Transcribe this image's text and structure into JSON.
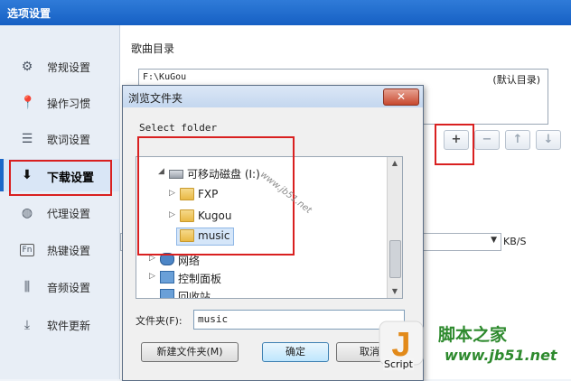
{
  "window": {
    "title": "选项设置"
  },
  "sidebar": {
    "items": [
      {
        "label": "常规设置",
        "icon": "gear-icon"
      },
      {
        "label": "操作习惯",
        "icon": "pin-icon"
      },
      {
        "label": "歌词设置",
        "icon": "lyrics-icon"
      },
      {
        "label": "下载设置",
        "icon": "download-icon",
        "active": true
      },
      {
        "label": "代理设置",
        "icon": "globe-icon"
      },
      {
        "label": "热键设置",
        "icon": "hotkey-icon"
      },
      {
        "label": "音频设置",
        "icon": "equalizer-icon"
      },
      {
        "label": "软件更新",
        "icon": "update-icon"
      }
    ]
  },
  "main": {
    "section_title": "歌曲目录",
    "directory": {
      "path": "F:\\KuGou",
      "note": "(默认目录)"
    },
    "speed_unit": "KB/S",
    "toolbar": {
      "add": "+",
      "remove": "−",
      "up": "↑",
      "down": "↓"
    }
  },
  "dialog": {
    "title": "浏览文件夹",
    "close": "✕",
    "instruction": "Select folder",
    "tree": [
      {
        "label": "可移动磁盘 (I:)",
        "type": "drive",
        "expanded": true
      },
      {
        "label": "FXP",
        "type": "folder"
      },
      {
        "label": "Kugou",
        "type": "folder"
      },
      {
        "label": "music",
        "type": "folder",
        "selected": true
      },
      {
        "label": "网络",
        "type": "network"
      },
      {
        "label": "控制面板",
        "type": "control-panel"
      },
      {
        "label": "回收站",
        "type": "recycle-bin"
      }
    ],
    "folder_label": "文件夹(F):",
    "folder_value": "music",
    "buttons": {
      "new_folder": "新建文件夹(M)",
      "ok": "确定",
      "cancel": "取消"
    }
  },
  "watermark": {
    "diagonal": "www.jb51.net",
    "logo_letter": "J",
    "logo_text": "脚本之家",
    "logo_url": "www.jb51.net",
    "script_tag": "Script"
  },
  "colors": {
    "highlight": "#d92020",
    "accent": "#1a67c8",
    "logo": "#2e8a2e"
  }
}
